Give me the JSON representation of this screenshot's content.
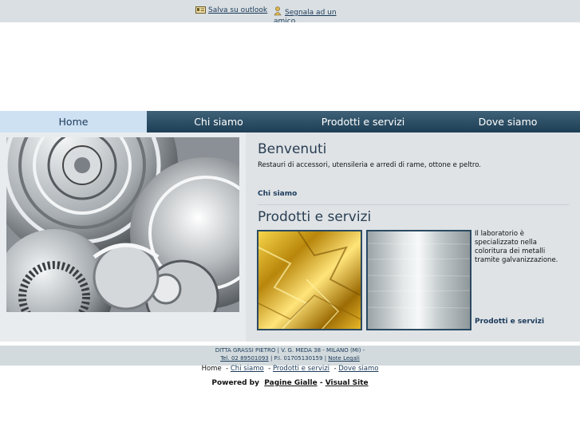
{
  "topbar": {
    "save_outlook": "Salva su outlook",
    "recommend_line1": "Segnala ad un",
    "recommend_line2": "amico"
  },
  "nav": {
    "items": [
      {
        "label": "Home",
        "active": true
      },
      {
        "label": "Chi siamo",
        "active": false
      },
      {
        "label": "Prodotti e servizi",
        "active": false
      },
      {
        "label": "Dove siamo",
        "active": false
      }
    ]
  },
  "welcome": {
    "title": "Benvenuti",
    "intro": "Restauri di accessori, utensileria e arredi di rame, ottone e peltro.",
    "link": "Chi siamo"
  },
  "products": {
    "title": "Prodotti e servizi",
    "text": "Il laboratorio è specializzato nella coloritura dei metalli tramite galvanizzazione.",
    "link": "Prodotti e servizi"
  },
  "footer": {
    "company": "DITTA GRASSI PIETRO | V. G. MEDA 38 - MILANO (MI) -",
    "tel": "Tel. 02 89501093",
    "piva": "P.I. 01705130159",
    "legal": "Note Legali",
    "sep": "|",
    "nav": [
      "Home",
      "Chi siamo",
      "Prodotti e servizi",
      "Dove siamo"
    ],
    "powered_label": "Powered by",
    "powered_by_1": "Pagine Gialle",
    "powered_by_2": "Visual Site",
    "powered_sep": "-"
  },
  "colors": {
    "nav_bg": "#2b4d63",
    "nav_active": "#cde1f2",
    "link": "#1c3a5a"
  }
}
